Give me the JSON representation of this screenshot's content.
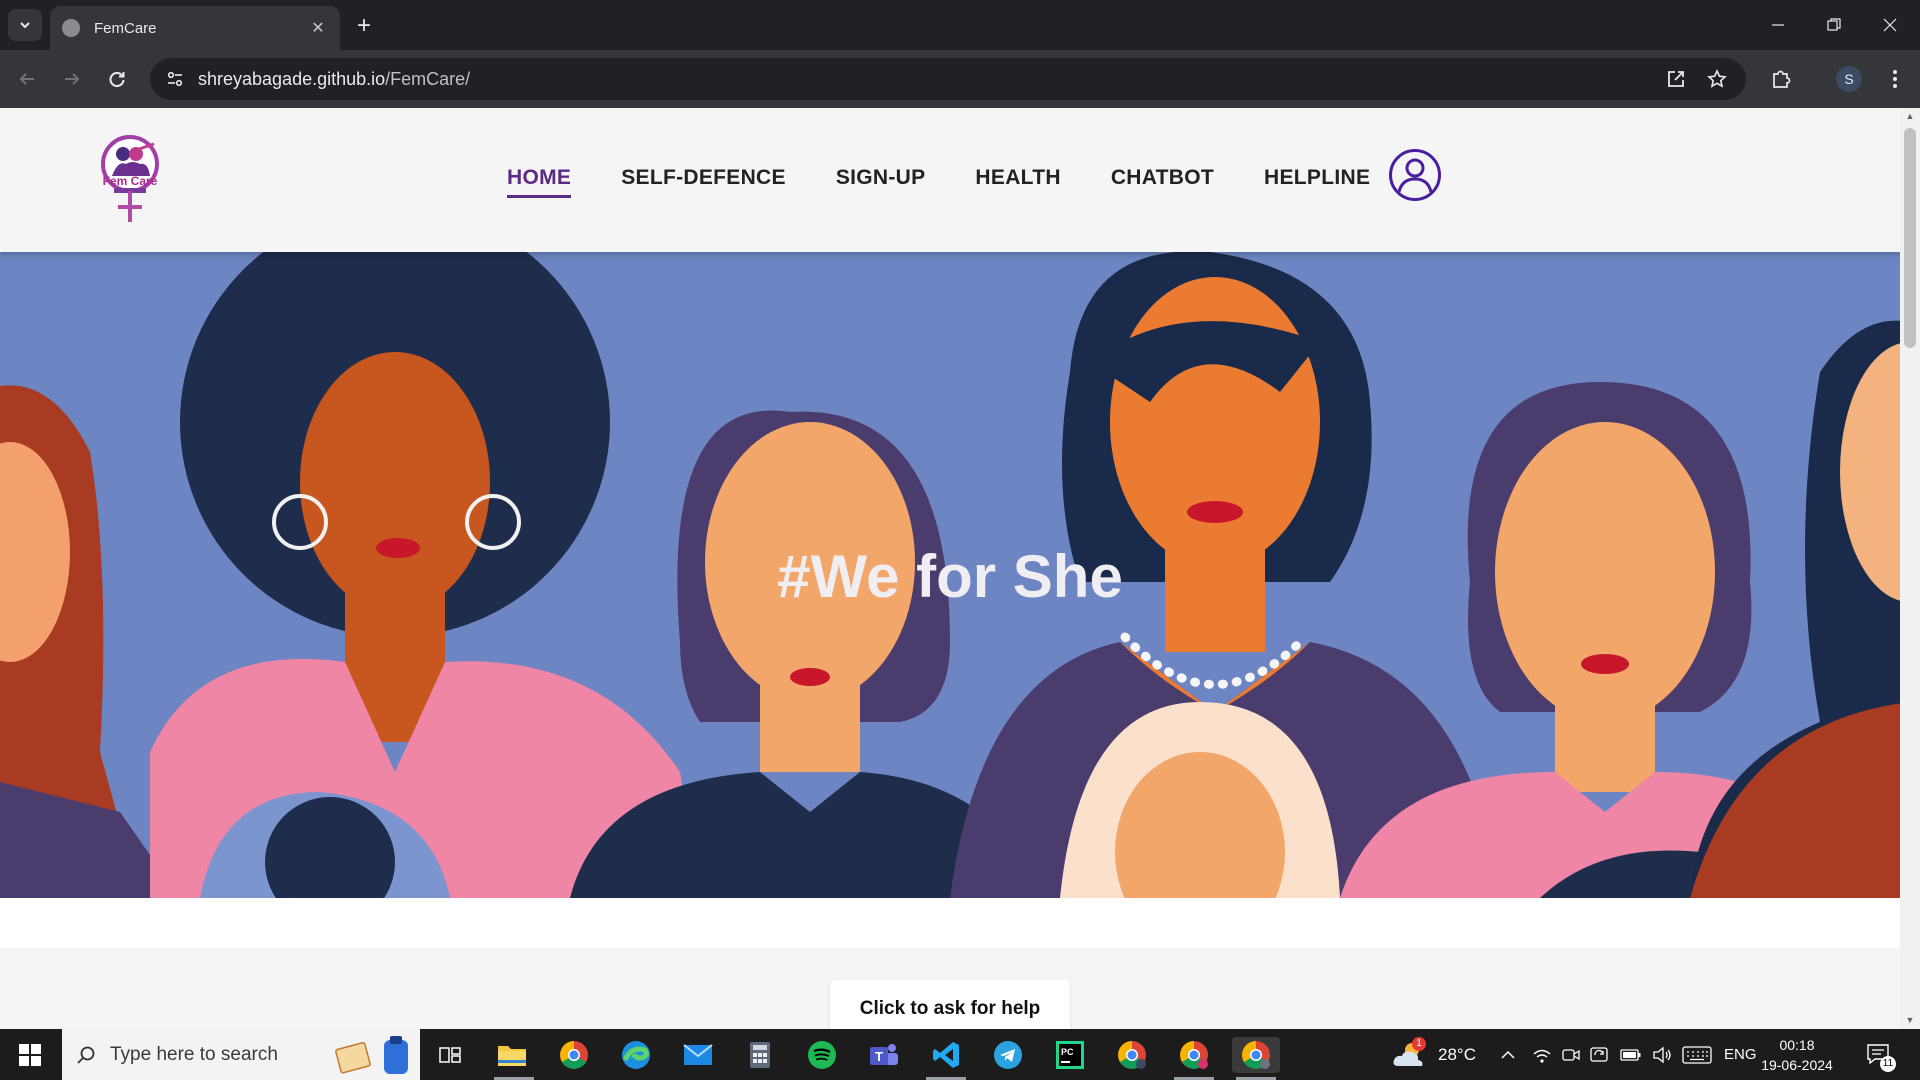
{
  "browser": {
    "tab_title": "FemCare",
    "url_host": "shreyabagade.github.io",
    "url_path": "/FemCare/",
    "profile_initial": "S"
  },
  "site": {
    "logo_text": "Fem Care",
    "nav": [
      {
        "label": "HOME",
        "active": true
      },
      {
        "label": "SELF-DEFENCE",
        "active": false
      },
      {
        "label": "SIGN-UP",
        "active": false
      },
      {
        "label": "HEALTH",
        "active": false
      },
      {
        "label": "CHATBOT",
        "active": false
      },
      {
        "label": "HELPLINE",
        "active": false
      }
    ],
    "hero_title": "#We for She",
    "help_button": "Click to ask for help",
    "accent_color": "#5b2a86"
  },
  "taskbar": {
    "search_placeholder": "Type here to search",
    "weather_badge": "1",
    "temperature": "28°C",
    "language": "ENG",
    "time": "00:18",
    "date": "19-06-2024",
    "notification_count": "11"
  }
}
